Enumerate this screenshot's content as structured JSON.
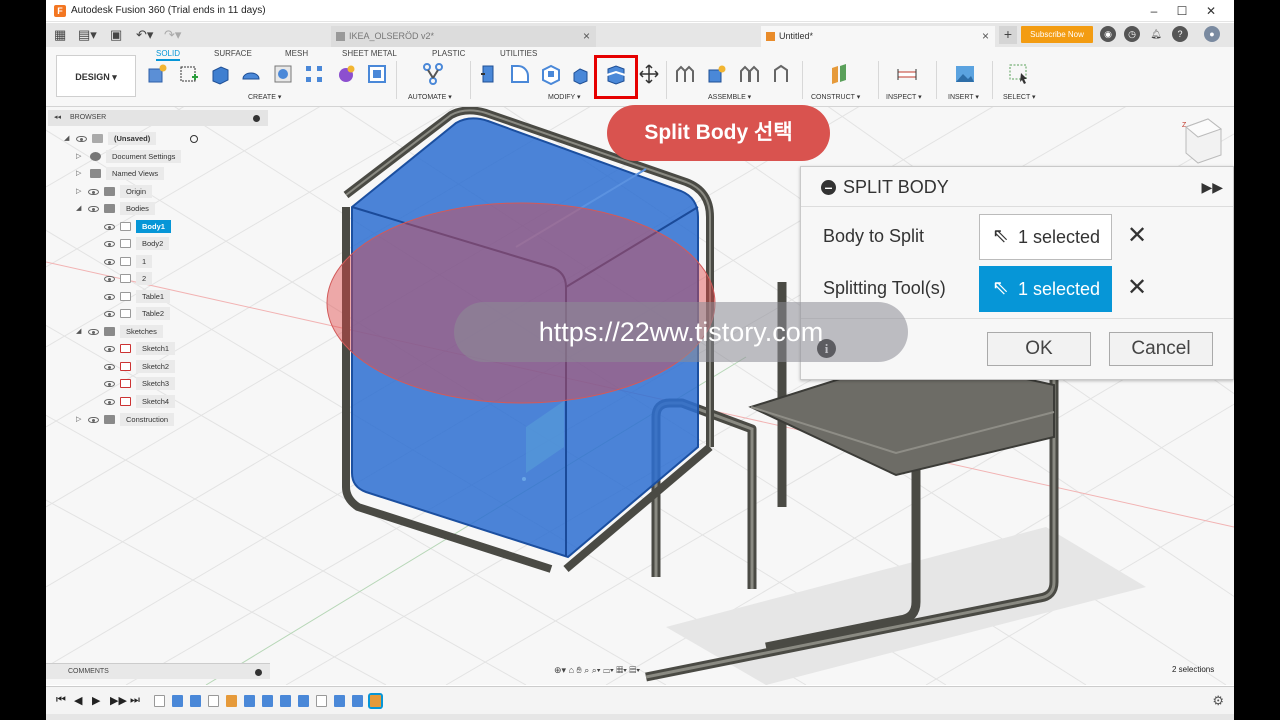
{
  "app": {
    "title": "Autodesk Fusion 360 (Trial ends in 11 days)",
    "logo_letter": "F"
  },
  "tabs": [
    {
      "label": "IKEA_OLSERÖD v2*"
    },
    {
      "label": "Untitled*"
    }
  ],
  "subscribe_label": "Subscribe Now",
  "toolbar": {
    "design_label": "DESIGN ▾",
    "workspace_tabs": [
      "SOLID",
      "SURFACE",
      "MESH",
      "SHEET METAL",
      "PLASTIC",
      "UTILITIES"
    ],
    "groups": [
      "CREATE ▾",
      "AUTOMATE ▾",
      "MODIFY ▾",
      "ASSEMBLE ▾",
      "CONSTRUCT ▾",
      "INSPECT ▾",
      "INSERT ▾",
      "SELECT ▾"
    ]
  },
  "browser": {
    "title": "BROWSER",
    "root": "(Unsaved)",
    "items": [
      "Document Settings",
      "Named Views",
      "Origin",
      "Bodies",
      "Body1",
      "Body2",
      "1",
      "2",
      "Table1",
      "Table2",
      "Sketches",
      "Sketch1",
      "Sketch2",
      "Sketch3",
      "Sketch4",
      "Construction"
    ]
  },
  "callout": "Split Body 선택",
  "panel": {
    "title": "SPLIT BODY",
    "body_to_split_label": "Body to Split",
    "body_to_split_value": "1 selected",
    "splitting_tool_label": "Splitting Tool(s)",
    "splitting_tool_value": "1 selected",
    "ok_label": "OK",
    "cancel_label": "Cancel"
  },
  "watermark": "https://22ww.tistory.com",
  "comments_label": "COMMENTS",
  "selection_count": "2 selections",
  "colors": {
    "accent": "#0696d7",
    "highlight": "#e60000",
    "callout": "#d9534f",
    "subscribe": "#f39c12",
    "body_selected": "#2d6ed1"
  }
}
